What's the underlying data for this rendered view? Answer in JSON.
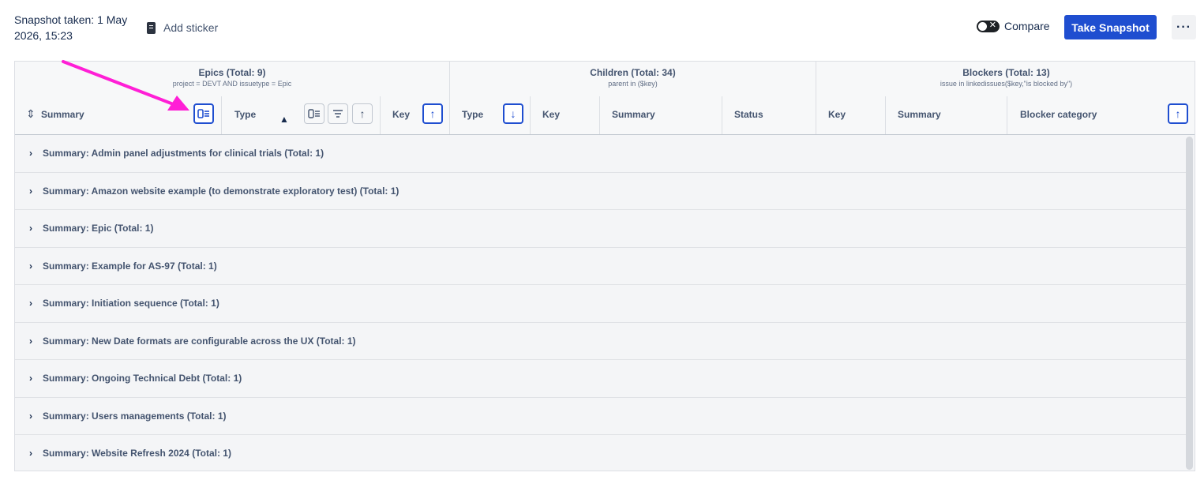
{
  "header": {
    "snapshot_text": "Snapshot taken: 1 May 2026, 15:23",
    "add_sticker_label": "Add sticker",
    "compare_label": "Compare",
    "take_snapshot_label": "Take Snapshot",
    "more_label": "···",
    "toggle_x": "✕"
  },
  "groups": [
    {
      "title": "Epics (Total: 9)",
      "query": "project = DEVT AND issuetype = Epic"
    },
    {
      "title": "Children (Total: 34)",
      "query": "parent in ($key)"
    },
    {
      "title": "Blockers (Total: 13)",
      "query": "issue in linkedissues($key,\"is blocked by\")"
    }
  ],
  "columns": {
    "epic_summary": "Summary",
    "epic_type": "Type",
    "epic_key": "Key",
    "child_type": "Type",
    "child_key": "Key",
    "child_summary": "Summary",
    "child_status": "Status",
    "blocker_key": "Key",
    "blocker_summary": "Summary",
    "blocker_category": "Blocker category"
  },
  "icons": {
    "group_by": "group-by-icon",
    "filter": "filter-icon",
    "sort_up": "↑",
    "sort_down": "↓",
    "sort_both": "sort-both-icon"
  },
  "rows": [
    "Summary: Admin panel adjustments for clinical trials (Total: 1)",
    "Summary: Amazon website example (to demonstrate exploratory test) (Total: 1)",
    "Summary: Epic (Total: 1)",
    "Summary: Example for AS-97 (Total: 1)",
    "Summary: Initiation sequence (Total: 1)",
    "Summary: New Date formats are configurable across the UX (Total: 1)",
    "Summary: Ongoing Technical Debt (Total: 1)",
    "Summary: Users managements (Total: 1)",
    "Summary: Website Refresh 2024 (Total: 1)"
  ],
  "colors": {
    "primary": "#1f4ed0",
    "annotation_arrow": "#ff1fd6"
  }
}
